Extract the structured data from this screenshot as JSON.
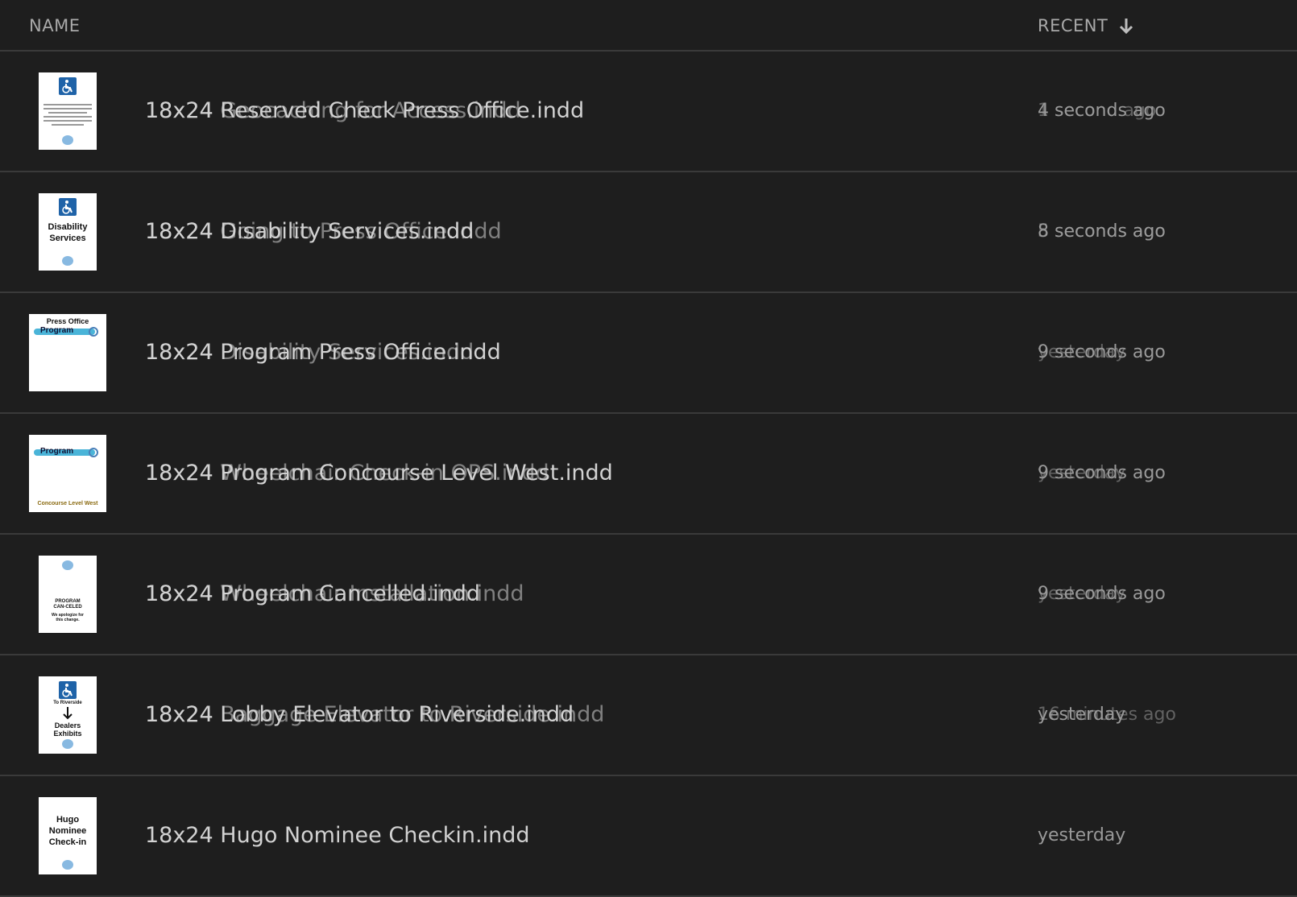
{
  "header": {
    "name_label": "NAME",
    "recent_label": "RECENT",
    "sort_icon": "arrow-down-icon"
  },
  "rows": [
    {
      "names": [
        "18x24 Reserved Check Press Office.indd",
        "18x24 Geocaching for Access.indd"
      ],
      "times": [
        "4 seconds ago",
        "1 second ago"
      ]
    },
    {
      "names": [
        "18x24 Disability Services.indd",
        "18x24 Going to Press Office.indd"
      ],
      "times": [
        "8 seconds ago",
        "5 seconds ago"
      ]
    },
    {
      "names": [
        "18x24 Program Press Office.indd",
        "18x24 Disability Services.indd"
      ],
      "times": [
        "9 seconds ago",
        "yesterday"
      ]
    },
    {
      "names": [
        "18x24 Program Concourse Level West.indd",
        "18x24 Wheelchair Check-in OPS.indd"
      ],
      "times": [
        "9 seconds ago",
        "yesterday"
      ]
    },
    {
      "names": [
        "18x24 Program Cancelled.indd",
        "18x24 Wheelchair Installation.indd"
      ],
      "times": [
        "9 seconds ago",
        "yesterday"
      ]
    },
    {
      "names": [
        "18x24 Lobby Elevator to Riverside.indd",
        "18x24 Baggage Elevator to Riverside.indd"
      ],
      "times": [
        "yesterday",
        "16 minutes ago"
      ]
    },
    {
      "names": [
        "18x24 Hugo Nominee Checkin.indd"
      ],
      "times": [
        "yesterday"
      ]
    }
  ],
  "thumbs": {
    "t2_line1": "Disability",
    "t2_line2": "Services",
    "t3_line1": "Press Office",
    "t3_prog": "Program",
    "t4_prog": "Program",
    "t4_bottom": "Concourse Level West",
    "t5_line1": "PROGRAM",
    "t5_line2": "CAN-CELED",
    "t5_line3": "We apologize for",
    "t5_line4": "this change.",
    "t6_line1": "To Riverside",
    "t6_line2": "Dealers",
    "t6_line3": "Exhibits",
    "t7_line1": "Hugo",
    "t7_line2": "Nominee",
    "t7_line3": "Check-in"
  }
}
